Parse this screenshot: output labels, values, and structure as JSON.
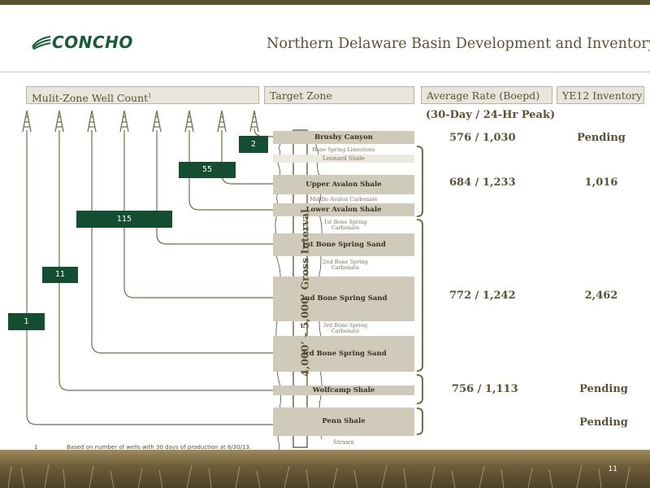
{
  "header": {
    "company": "CONCHO",
    "title": "Northern Delaware Basin Development and Inventory"
  },
  "columns": {
    "well_count": "Mulit-Zone Well Count",
    "well_count_sup": "1",
    "target_zone": "Target Zone",
    "avg_rate": "Average Rate (Boepd)",
    "avg_rate_sub": "(30-Day / 24-Hr Peak)",
    "inventory": "YE12 Inventory"
  },
  "well_counts": [
    "1",
    "11",
    "115",
    "55",
    "2"
  ],
  "zones": {
    "brushy_canyon": "Brushy Canyon",
    "bone_spring_limestone": "Bone Spring Limestone",
    "leonard_shale": "Leonard Shale",
    "upper_avalon": "Upper Avalon Shale",
    "middle_avalon": "Middle Avalon Carbonate",
    "lower_avalon": "Lower Avalon Shale",
    "bs1_carb": "1st Bone Spring Carbonate",
    "bs1_sand": "1st Bone Spring Sand",
    "bs2_carb": "2nd Bone Spring Carbonate",
    "bs2_sand": "2nd Bone Spring Sand",
    "bs3_carb": "3rd Bone Spring Carbonate",
    "bs3_sand": "3rd Bone Spring Sand",
    "wolfcamp": "Wolfcamp Shale",
    "penn": "Penn Shale",
    "strawn": "Strawn"
  },
  "gross_interval": "4,000’ – 5,000’ Gross Interval",
  "rates": [
    "576 / 1,030",
    "684 / 1,233",
    "772 / 1,242",
    "756 / 1,113"
  ],
  "inventory": [
    "Pending",
    "1,016",
    "2,462",
    "Pending",
    "Pending"
  ],
  "footnote": {
    "number": "1",
    "text": "Based on number of wells with 30 days of production at 6/30/13."
  },
  "page_number": "11",
  "colors": {
    "box_green": "#154d33",
    "text_brown": "#5b5135",
    "line_brown": "#7a6a48",
    "zone_shade": "#cfcab9"
  }
}
